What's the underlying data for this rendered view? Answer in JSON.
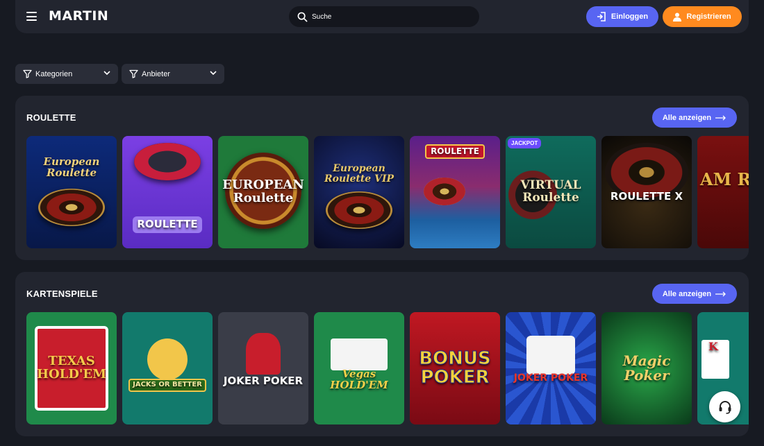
{
  "header": {
    "logo": "MARTIN",
    "search_placeholder": "Suche",
    "login_label": "Einloggen",
    "register_label": "Registrieren"
  },
  "filters": [
    {
      "label": "Kategorien"
    },
    {
      "label": "Anbieter"
    }
  ],
  "sections": [
    {
      "title": "ROULETTE",
      "all_label": "Alle anzeigen",
      "games": [
        {
          "title": "European Roulette",
          "badge": ""
        },
        {
          "title": "ROULETTE",
          "badge": ""
        },
        {
          "title": "EUROPEAN Roulette",
          "badge": ""
        },
        {
          "title": "European Roulette VIP",
          "badge": ""
        },
        {
          "title": "ROULETTE",
          "badge": ""
        },
        {
          "title": "VIRTUAL Roulette",
          "badge": "JACKPOT"
        },
        {
          "title": "ROULETTE X",
          "badge": ""
        },
        {
          "title": "AM Rou",
          "badge": ""
        }
      ]
    },
    {
      "title": "KARTENSPIELE",
      "all_label": "Alle anzeigen",
      "games": [
        {
          "title": "TEXAS HOLD'EM"
        },
        {
          "title": "JACKS OR BETTER"
        },
        {
          "title": "JOKER POKER"
        },
        {
          "title": "Vegas HOLD'EM"
        },
        {
          "title": "BONUS POKER"
        },
        {
          "title": "JOKER POKER"
        },
        {
          "title": "Magic Poker"
        },
        {
          "title": "K"
        }
      ]
    }
  ],
  "colors": {
    "background": "#171a22",
    "panel": "#22252f",
    "accent_blue": "#5865f2",
    "accent_orange": "#ff8a1f"
  },
  "icons": [
    "menu-icon",
    "search-icon",
    "login-icon",
    "user-icon",
    "filter-icon",
    "chevron-down-icon",
    "arrow-right-icon",
    "headset-icon"
  ]
}
